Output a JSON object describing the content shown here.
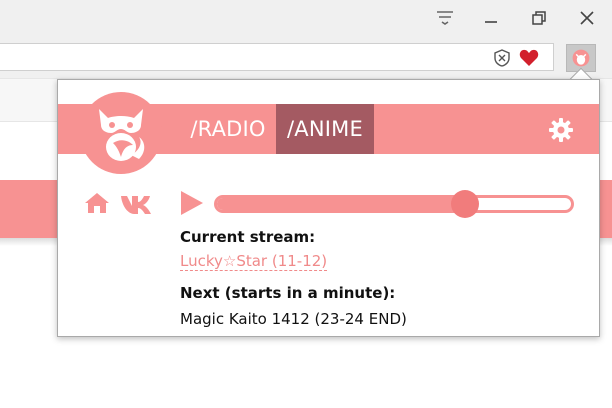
{
  "colors": {
    "accent": "#f79292",
    "tab_active": "#a45a62",
    "link": "#f08a8a",
    "heart": "#d2202c"
  },
  "popup": {
    "tabs": [
      {
        "label": "/RADIO",
        "active": false
      },
      {
        "label": "/ANIME",
        "active": true
      }
    ],
    "player": {
      "volume_percent": 70
    },
    "current_stream_label": "Current stream:",
    "current_stream_value": "Lucky☆Star (11-12)",
    "next_label": "Next (starts in a minute):",
    "next_value": "Magic Kaito 1412 (23-24 END)"
  },
  "icons": {
    "window": [
      "menu-icon",
      "minimize-icon",
      "restore-icon",
      "close-icon"
    ],
    "address": [
      "shield-x-icon",
      "heart-icon",
      "fox-extension-icon"
    ],
    "popup": [
      "fox-logo-icon",
      "gear-icon",
      "home-icon",
      "vk-icon",
      "play-icon"
    ]
  }
}
